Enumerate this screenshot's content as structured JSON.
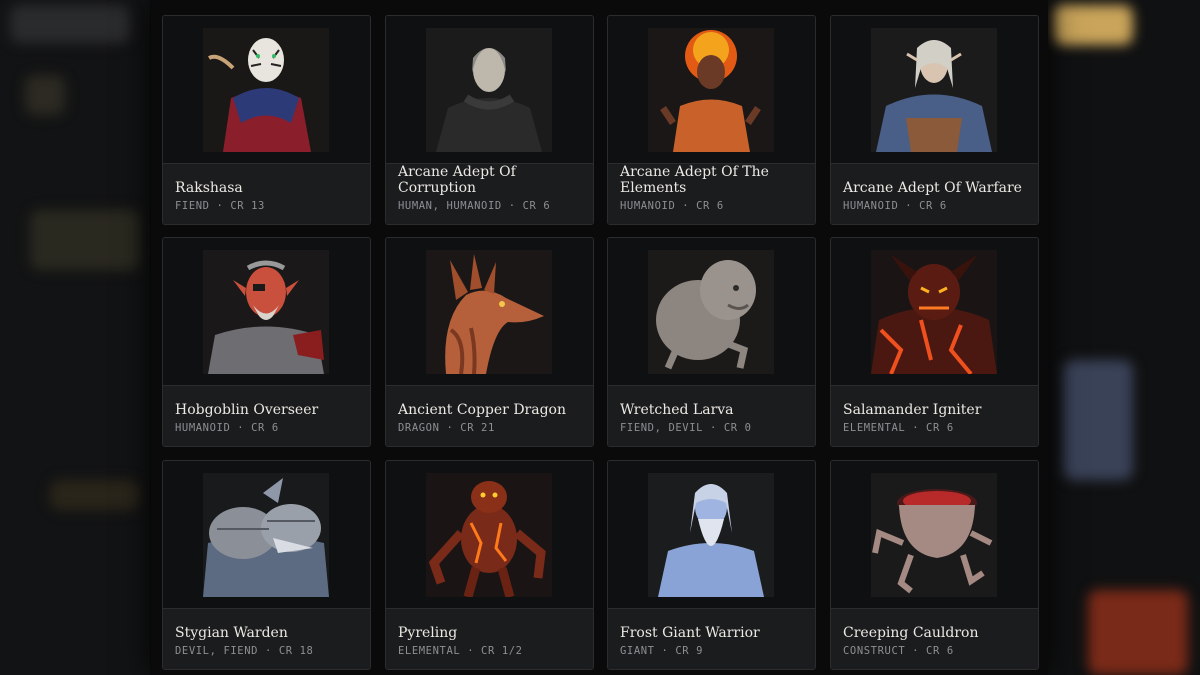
{
  "monsters": [
    {
      "name": "Rakshasa",
      "meta": "FIEND · CR 13",
      "portrait_icon": "tiger-humanoid-portrait"
    },
    {
      "name": "Arcane Adept Of Corruption",
      "meta": "HUMAN, HUMANOID · CR 6",
      "portrait_icon": "hooded-elder-portrait"
    },
    {
      "name": "Arcane Adept Of The Elements",
      "meta": "HUMANOID · CR 6",
      "portrait_icon": "fire-mage-portrait"
    },
    {
      "name": "Arcane Adept Of Warfare",
      "meta": "HUMANOID · CR 6",
      "portrait_icon": "elf-warrior-portrait"
    },
    {
      "name": "Hobgoblin Overseer",
      "meta": "HUMANOID · CR 6",
      "portrait_icon": "hobgoblin-portrait"
    },
    {
      "name": "Ancient Copper Dragon",
      "meta": "DRAGON · CR 21",
      "portrait_icon": "dragon-head-portrait"
    },
    {
      "name": "Wretched Larva",
      "meta": "FIEND, DEVIL · CR 0",
      "portrait_icon": "larva-portrait"
    },
    {
      "name": "Salamander Igniter",
      "meta": "ELEMENTAL · CR 6",
      "portrait_icon": "lava-demon-portrait"
    },
    {
      "name": "Stygian Warden",
      "meta": "DEVIL, FIEND · CR 18",
      "portrait_icon": "armored-shark-portrait"
    },
    {
      "name": "Pyreling",
      "meta": "ELEMENTAL · CR 1/2",
      "portrait_icon": "fire-imp-portrait"
    },
    {
      "name": "Frost Giant Warrior",
      "meta": "GIANT · CR 9",
      "portrait_icon": "frost-giant-portrait"
    },
    {
      "name": "Creeping Cauldron",
      "meta": "CONSTRUCT · CR 6",
      "portrait_icon": "cauldron-creature-portrait"
    }
  ],
  "colors": {
    "card_bg": "#141516",
    "card_info_bg": "#1b1c1e",
    "title_text": "#ece9e3",
    "meta_text": "#8d8f92"
  }
}
